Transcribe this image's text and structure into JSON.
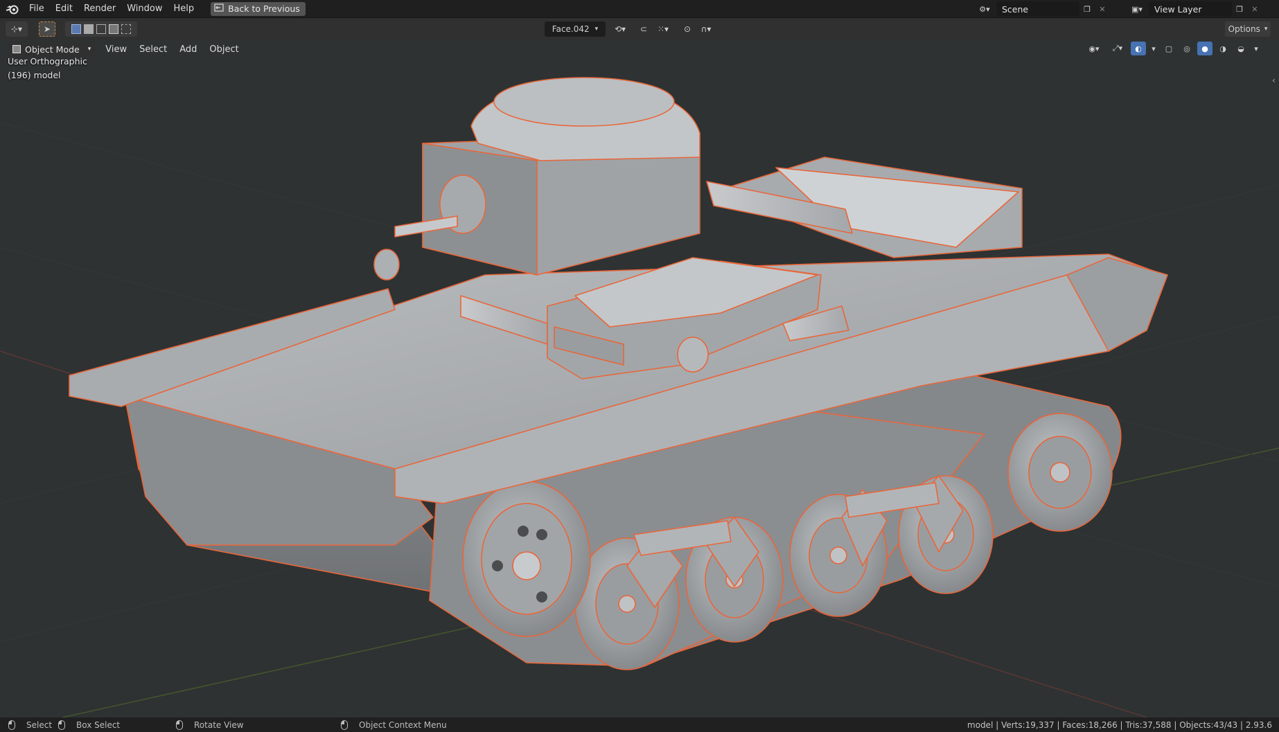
{
  "menu": {
    "items": [
      "File",
      "Edit",
      "Render",
      "Window",
      "Help"
    ],
    "back_button": "Back to Previous"
  },
  "scene": {
    "label": "Scene",
    "view_layer": "View Layer"
  },
  "toolbar": {
    "face_dropdown": "Face.042",
    "options": "Options"
  },
  "viewport_header": {
    "mode": "Object Mode",
    "menus": [
      "View",
      "Select",
      "Add",
      "Object"
    ]
  },
  "overlay": {
    "view_name": "User Orthographic",
    "object_info": "(196) model"
  },
  "statusbar": {
    "select": "Select",
    "box_select": "Box Select",
    "rotate_view": "Rotate View",
    "context_menu": "Object Context Menu",
    "stats": "model | Verts:19,337 | Faces:18,266 | Tris:37,588 | Objects:43/43 | 2.93.6"
  },
  "colors": {
    "selection_outline": "#e8663a",
    "viewport_bg": "#2e3232",
    "grid_x_axis": "#8a3a3a",
    "grid_y_axis": "#5a7a2a"
  },
  "icons": [
    "blender-logo-icon",
    "back-icon",
    "scene-icon",
    "view-layer-icon",
    "editor-type-icon",
    "select-cursor-icon",
    "select-mode-icons",
    "pivot-icon",
    "snap-icon",
    "proportional-icon",
    "visibility-icon",
    "gizmo-icon",
    "overlay-icon",
    "xray-icon",
    "shading-icons",
    "mouse-icon"
  ]
}
